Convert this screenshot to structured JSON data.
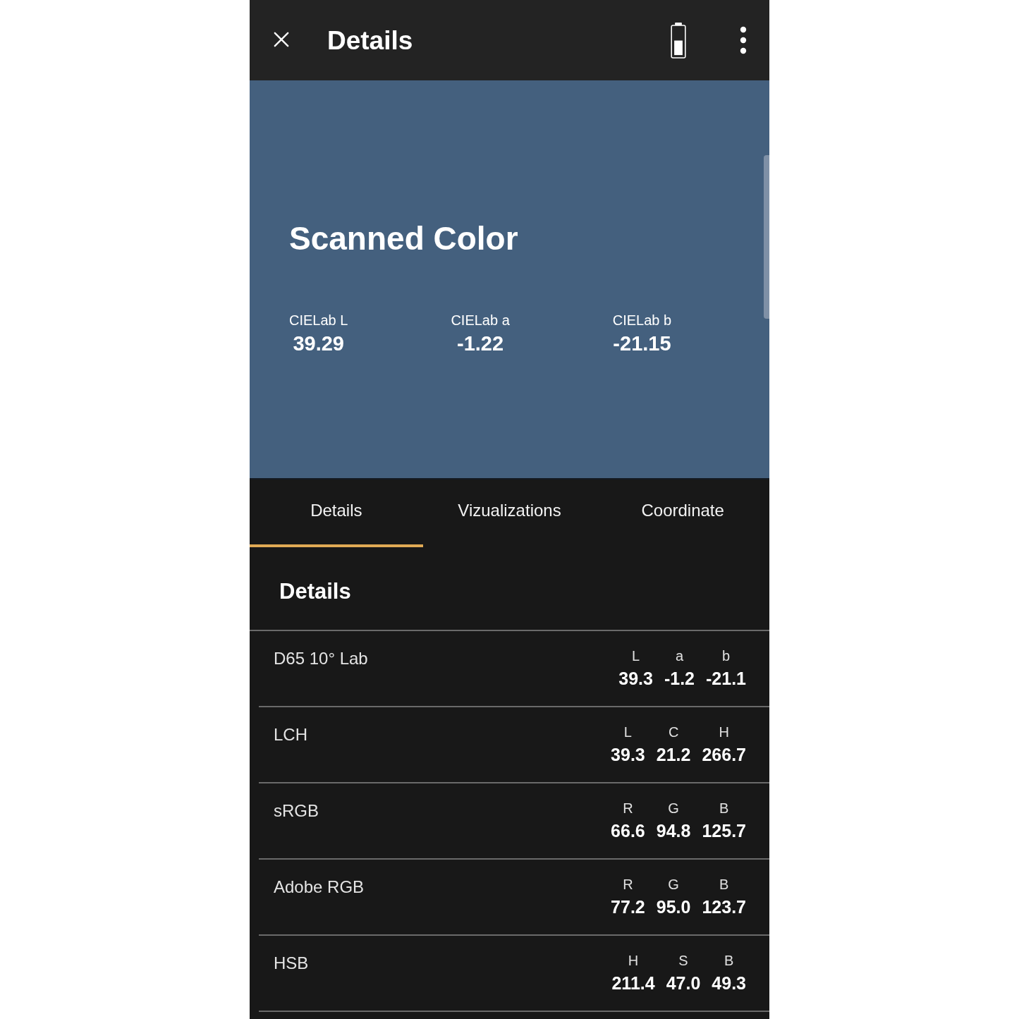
{
  "top_bar": {
    "title": "Details"
  },
  "scanned_color": {
    "title": "Scanned Color",
    "values": [
      {
        "label": "CIELab L",
        "value": "39.29"
      },
      {
        "label": "CIELab a",
        "value": "-1.22"
      },
      {
        "label": "CIELab b",
        "value": "-21.15"
      }
    ]
  },
  "tabs": [
    {
      "label": "Details",
      "selected": true
    },
    {
      "label": "Vizualizations",
      "selected": false
    },
    {
      "label": "Coordinate",
      "selected": false
    }
  ],
  "section": {
    "title": "Details"
  },
  "color_spaces": [
    {
      "name": "D65 10° Lab",
      "components": [
        {
          "label": "L",
          "value": "39.3"
        },
        {
          "label": "a",
          "value": "-1.2"
        },
        {
          "label": "b",
          "value": "-21.1"
        }
      ]
    },
    {
      "name": "LCH",
      "components": [
        {
          "label": "L",
          "value": "39.3"
        },
        {
          "label": "C",
          "value": "21.2"
        },
        {
          "label": "H",
          "value": "266.7"
        }
      ]
    },
    {
      "name": "sRGB",
      "components": [
        {
          "label": "R",
          "value": "66.6"
        },
        {
          "label": "G",
          "value": "94.8"
        },
        {
          "label": "B",
          "value": "125.7"
        }
      ]
    },
    {
      "name": "Adobe RGB",
      "components": [
        {
          "label": "R",
          "value": "77.2"
        },
        {
          "label": "G",
          "value": "95.0"
        },
        {
          "label": "B",
          "value": "123.7"
        }
      ]
    },
    {
      "name": "HSB",
      "components": [
        {
          "label": "H",
          "value": "211.4"
        },
        {
          "label": "S",
          "value": "47.0"
        },
        {
          "label": "B",
          "value": "49.3"
        }
      ]
    }
  ]
}
